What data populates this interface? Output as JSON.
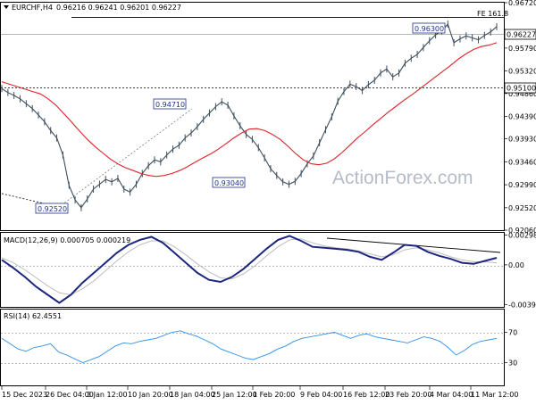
{
  "header": {
    "symbol_tf": "EURCHF,H4",
    "ohlc": "0.96216 0.96241 0.96201 0.96227"
  },
  "watermark": "ActionForex.com",
  "price_panel": {
    "ylim": [
      0.9206,
      0.9672
    ],
    "y_ticks": [
      "0.96720",
      "0.96227",
      "0.95790",
      "0.95320",
      "0.95100",
      "0.94860",
      "0.94390",
      "0.93930",
      "0.93460",
      "0.92990",
      "0.92520",
      "0.92060"
    ],
    "current_price": "0.96227",
    "level_line": "0.95100",
    "fe_label": "FE 161.8",
    "callouts": [
      {
        "label": "0.92520",
        "value": 0.9252
      },
      {
        "label": "0.94710",
        "value": 0.9471
      },
      {
        "label": "0.93040",
        "value": 0.9304
      },
      {
        "label": "0.96300",
        "value": 0.963
      }
    ]
  },
  "macd_panel": {
    "title": "MACD(12,26,9) 0.000705 0.000219",
    "y_ticks": [
      "0.002985",
      "0.00",
      "-0.00396"
    ]
  },
  "rsi_panel": {
    "title": "RSI(14) 62.4551",
    "y_ticks": [
      "70",
      "30"
    ]
  },
  "x_ticks": [
    "15 Dec 2023",
    "26 Dec 04:00",
    "3 Jan 12:00",
    "10 Jan 20:00",
    "18 Jan 04:00",
    "25 Jan 12:00",
    "1 Feb 20:00",
    "9 Feb 04:00",
    "16 Feb 12:00",
    "23 Feb 20:00",
    "4 Mar 04:00",
    "11 Mar 12:00"
  ],
  "colors": {
    "price": "#3d4e5c",
    "ma": "#e0222a",
    "macd": "#1c2680",
    "signal": "#bdbdbd",
    "rsi": "#2f8fe6",
    "callout": "#1f2f8f"
  },
  "chart_data": [
    {
      "type": "line",
      "title": "EURCHF,H4",
      "series": [
        {
          "values": [
            0.9496,
            0.9488,
            0.9482,
            0.9475,
            0.9465,
            0.9455,
            0.9442,
            0.9428,
            0.941,
            0.9395,
            0.936,
            0.9298,
            0.9268,
            0.9252,
            0.927,
            0.929,
            0.93,
            0.931,
            0.9305,
            0.9312,
            0.929,
            0.9284,
            0.93,
            0.9322,
            0.9338,
            0.935,
            0.9346,
            0.936,
            0.9372,
            0.938,
            0.9395,
            0.9405,
            0.9418,
            0.9433,
            0.9446,
            0.9459,
            0.9469,
            0.9462,
            0.944,
            0.942,
            0.9402,
            0.9392,
            0.9375,
            0.9354,
            0.9332,
            0.9318,
            0.9305,
            0.93,
            0.9306,
            0.9322,
            0.9342,
            0.9358,
            0.9385,
            0.9412,
            0.9438,
            0.947,
            0.949,
            0.9505,
            0.95,
            0.9492,
            0.9504,
            0.9513,
            0.9528,
            0.9536,
            0.952,
            0.9528,
            0.9548,
            0.9558,
            0.9566,
            0.958,
            0.9594,
            0.9606,
            0.9614,
            0.9628,
            0.959,
            0.9598,
            0.9604,
            0.96,
            0.9596,
            0.9605,
            0.9612,
            0.9623
          ]
        },
        {
          "name": "MA",
          "values": [
            0.951,
            0.9505,
            0.95,
            0.9495,
            0.949,
            0.9485,
            0.9475,
            0.9462,
            0.9445,
            0.9428,
            0.941,
            0.9393,
            0.9378,
            0.9365,
            0.9352,
            0.9342,
            0.9334,
            0.9328,
            0.9322,
            0.9318,
            0.9316,
            0.9318,
            0.9322,
            0.9328,
            0.9336,
            0.9345,
            0.9354,
            0.9362,
            0.9372,
            0.9383,
            0.9395,
            0.9405,
            0.9413,
            0.9414,
            0.941,
            0.9402,
            0.9392,
            0.9378,
            0.9363,
            0.935,
            0.9342,
            0.934,
            0.9343,
            0.9352,
            0.9365,
            0.938,
            0.9395,
            0.9408,
            0.9422,
            0.9435,
            0.9448,
            0.946,
            0.9472,
            0.9483,
            0.9495,
            0.9507,
            0.9519,
            0.9531,
            0.9543,
            0.9556,
            0.9567,
            0.9576,
            0.9582,
            0.9585,
            0.959
          ]
        }
      ],
      "ylim": [
        0.9206,
        0.9672
      ]
    },
    {
      "type": "line",
      "title": "MACD(12,26,9) 0.000705 0.000219",
      "series": [
        {
          "name": "MACD",
          "values": [
            0.0005,
            -0.0003,
            -0.0012,
            -0.0022,
            -0.003,
            -0.0038,
            -0.003,
            -0.0018,
            -0.0008,
            0.0002,
            0.0012,
            0.002,
            0.0025,
            0.0028,
            0.0022,
            0.0012,
            0.0002,
            -0.0008,
            -0.0015,
            -0.0017,
            -0.0012,
            -0.0004,
            0.0006,
            0.0016,
            0.0025,
            0.0029,
            0.0024,
            0.0018,
            0.0017,
            0.0016,
            0.0015,
            0.0013,
            0.0008,
            0.0005,
            0.0012,
            0.002,
            0.0019,
            0.0013,
            0.0009,
            0.0006,
            0.0002,
            0.0001,
            0.0004,
            0.0007
          ]
        },
        {
          "name": "Signal",
          "values": [
            0.0007,
            0.0002,
            -0.0005,
            -0.0013,
            -0.0021,
            -0.0028,
            -0.003,
            -0.0024,
            -0.0016,
            -0.0006,
            0.0004,
            0.0013,
            0.002,
            0.0024,
            0.0024,
            0.0018,
            0.001,
            0.0001,
            -0.0007,
            -0.0013,
            -0.0014,
            -0.0009,
            -0.0001,
            0.0009,
            0.0018,
            0.0025,
            0.0026,
            0.0022,
            0.0019,
            0.0017,
            0.0016,
            0.0014,
            0.0011,
            0.0008,
            0.001,
            0.0015,
            0.0017,
            0.0015,
            0.0012,
            0.0008,
            0.0005,
            0.0003,
            0.0003,
            0.0002
          ]
        }
      ],
      "ylim": [
        -0.0042,
        0.0032
      ]
    },
    {
      "type": "line",
      "title": "RSI(14) 62.4551",
      "series": [
        {
          "name": "RSI",
          "values": [
            62,
            55,
            48,
            45,
            50,
            52,
            55,
            44,
            40,
            35,
            30,
            34,
            38,
            45,
            52,
            56,
            55,
            58,
            60,
            62,
            66,
            70,
            72,
            68,
            65,
            60,
            55,
            48,
            44,
            40,
            36,
            34,
            38,
            42,
            48,
            52,
            58,
            62,
            64,
            66,
            68,
            70,
            66,
            62,
            66,
            68,
            64,
            62,
            60,
            58,
            56,
            60,
            64,
            62,
            58,
            50,
            40,
            46,
            54,
            58,
            60,
            62
          ]
        }
      ],
      "ylim": [
        0,
        100
      ]
    }
  ]
}
